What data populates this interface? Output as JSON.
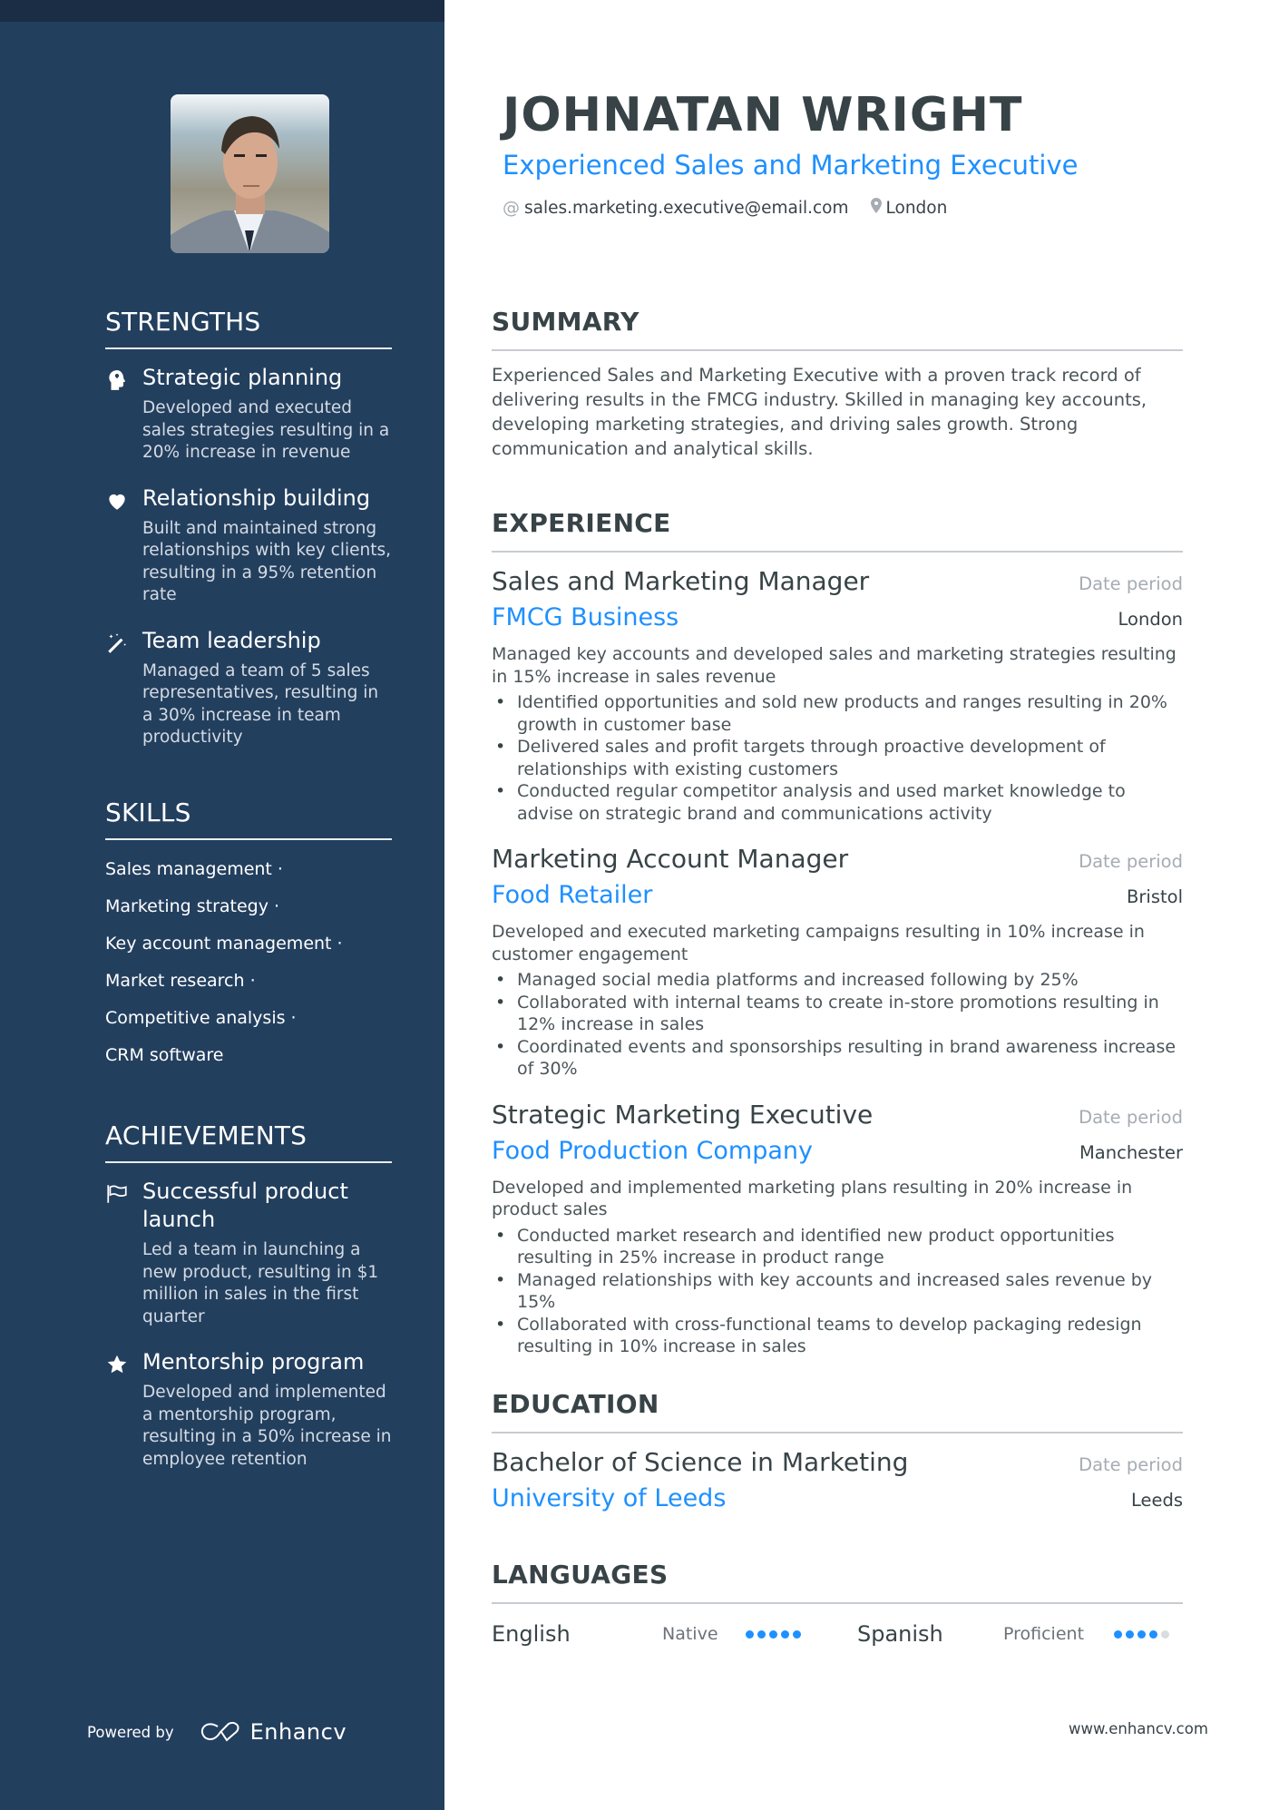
{
  "header": {
    "name": "JOHNATAN WRIGHT",
    "title": "Experienced Sales and Marketing Executive",
    "email": "sales.marketing.executive@email.com",
    "location": "London",
    "email_icon": "at-icon",
    "location_icon": "map-pin-icon"
  },
  "sidebar": {
    "photo_alt": "Profile photo",
    "strengths": {
      "heading": "STRENGTHS",
      "items": [
        {
          "icon": "head-brain-icon",
          "title": "Strategic planning",
          "desc": "Developed and executed sales strategies resulting in a 20% increase in revenue"
        },
        {
          "icon": "heart-icon",
          "title": "Relationship building",
          "desc": "Built and maintained strong relationships with key clients, resulting in a 95% retention rate"
        },
        {
          "icon": "magic-wand-icon",
          "title": "Team leadership",
          "desc": "Managed a team of 5 sales representatives, resulting in a 30% increase in team productivity"
        }
      ]
    },
    "skills": {
      "heading": "SKILLS",
      "items": [
        "Sales management ·",
        "Marketing strategy ·",
        "Key account management ·",
        "Market research ·",
        "Competitive analysis ·",
        "CRM software"
      ]
    },
    "achievements": {
      "heading": "ACHIEVEMENTS",
      "items": [
        {
          "icon": "flag-icon",
          "title": "Successful product launch",
          "desc": "Led a team in launching a new product, resulting in $1 million in sales in the first quarter"
        },
        {
          "icon": "star-icon",
          "title": "Mentorship program",
          "desc": "Developed and implemented a mentorship program, resulting in a 50% increase in employee retention"
        }
      ]
    },
    "footer": {
      "powered_by": "Powered by",
      "brand": "Enhancv"
    }
  },
  "main": {
    "summary": {
      "heading": "SUMMARY",
      "text": "Experienced Sales and Marketing Executive with a proven track record of delivering results in the FMCG industry. Skilled in managing key accounts, developing marketing strategies, and driving sales growth. Strong communication and analytical skills."
    },
    "experience": {
      "heading": "EXPERIENCE",
      "jobs": [
        {
          "role": "Sales and Marketing Manager",
          "date": "Date period",
          "company": "FMCG Business",
          "location": "London",
          "desc": "Managed key accounts and developed sales and marketing strategies resulting in 15% increase in sales revenue",
          "bullets": [
            "Identified opportunities and sold new products and ranges resulting in 20% growth in customer base",
            "Delivered sales and profit targets through proactive development of relationships with existing customers",
            "Conducted regular competitor analysis and used market knowledge to advise on strategic brand and communications activity"
          ]
        },
        {
          "role": "Marketing Account Manager",
          "date": "Date period",
          "company": "Food Retailer",
          "location": "Bristol",
          "desc": "Developed and executed marketing campaigns resulting in 10% increase in customer engagement",
          "bullets": [
            "Managed social media platforms and increased following by 25%",
            "Collaborated with internal teams to create in-store promotions resulting in 12% increase in sales",
            "Coordinated events and sponsorships resulting in brand awareness increase of 30%"
          ]
        },
        {
          "role": "Strategic Marketing Executive",
          "date": "Date period",
          "company": "Food Production Company",
          "location": "Manchester",
          "desc": "Developed and implemented marketing plans resulting in 20% increase in product sales",
          "bullets": [
            "Conducted market research and identified new product opportunities resulting in 25% increase in product range",
            "Managed relationships with key accounts and increased sales revenue by 15%",
            "Collaborated with cross-functional teams to develop packaging redesign resulting in 10% increase in sales"
          ]
        }
      ]
    },
    "education": {
      "heading": "EDUCATION",
      "degree": "Bachelor of Science in Marketing",
      "date": "Date period",
      "school": "University of Leeds",
      "location": "Leeds"
    },
    "languages": {
      "heading": "LANGUAGES",
      "items": [
        {
          "name": "English",
          "level": "Native",
          "rating": 5,
          "max": 5
        },
        {
          "name": "Spanish",
          "level": "Proficient",
          "rating": 4,
          "max": 5
        }
      ]
    },
    "footer_site": "www.enhancv.com"
  },
  "colors": {
    "sidebar_bg": "#233f5e",
    "sidebar_band": "#1b2d45",
    "accent": "#1e90ff",
    "text_dark": "#384347",
    "muted": "#a6acb2"
  }
}
